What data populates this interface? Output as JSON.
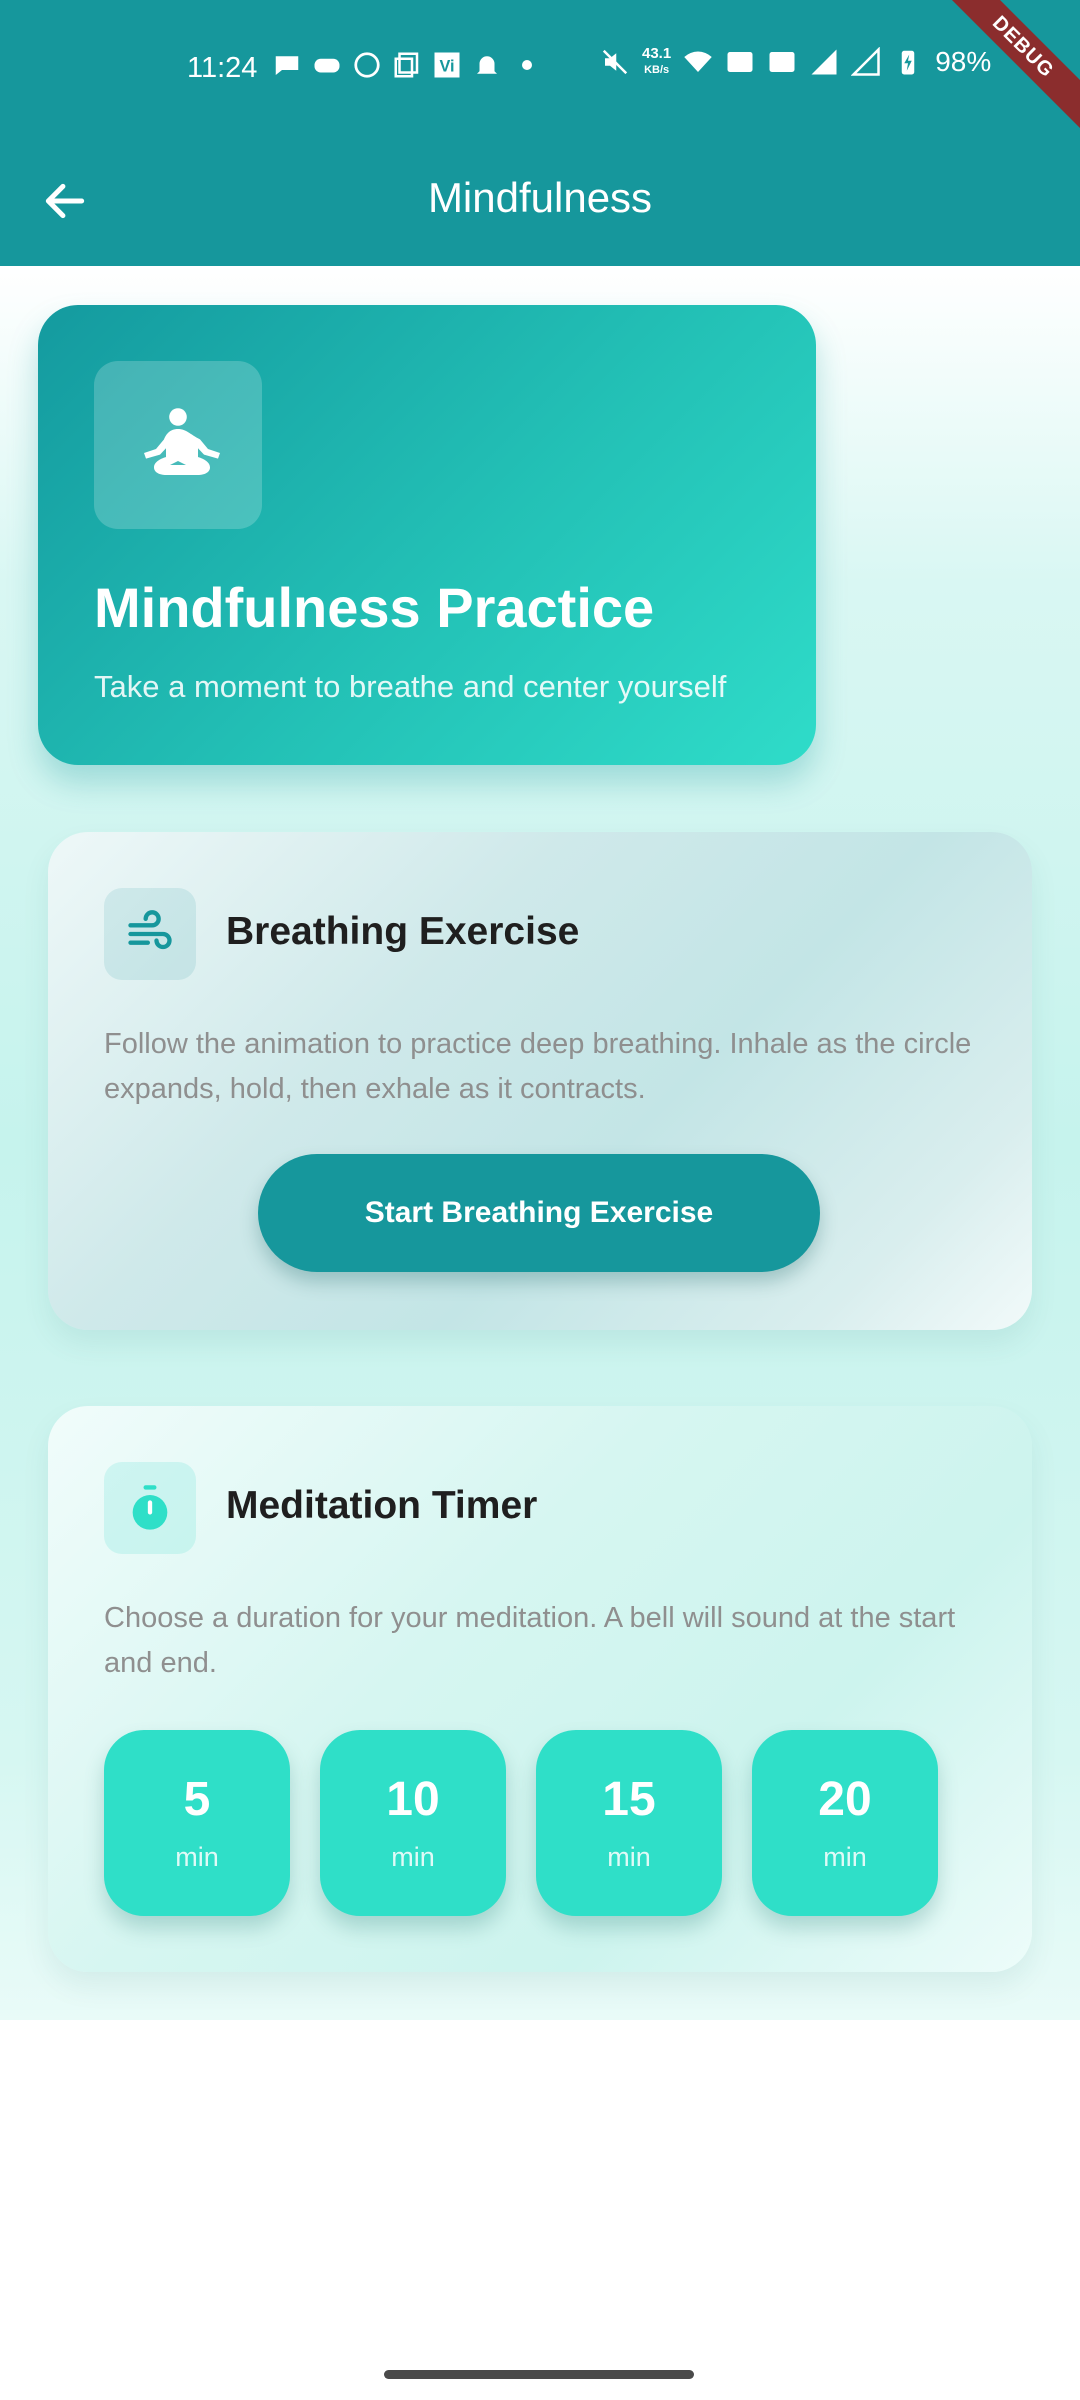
{
  "status_bar": {
    "time": "11:24",
    "network_speed_value": "43.1",
    "network_speed_unit": "KB/s",
    "battery": "98%",
    "icons": [
      "chat-bubble-icon",
      "gamepad-icon",
      "whatsapp-icon",
      "copy-icon",
      "vi-icon",
      "bell-icon",
      "dot-icon",
      "mute-icon",
      "wifi-icon",
      "vowifi-icon",
      "volte-icon",
      "signal-icon",
      "signal-icon-2",
      "battery-charging-icon"
    ]
  },
  "debug_banner": "DEBUG",
  "app_bar": {
    "title": "Mindfulness",
    "back_icon": "arrow-back-icon"
  },
  "hero": {
    "icon": "meditation-icon",
    "title": "Mindfulness Practice",
    "subtitle": "Take a moment to breathe and center yourself"
  },
  "breathing": {
    "icon": "wind-icon",
    "title": "Breathing Exercise",
    "description": "Follow the animation to practice deep breathing. Inhale as the circle expands, hold, then exhale as it contracts.",
    "button_label": "Start Breathing Exercise"
  },
  "timer": {
    "icon": "stopwatch-icon",
    "title": "Meditation Timer",
    "description": "Choose a duration for your meditation. A bell will sound at the start and end.",
    "durations": [
      {
        "value": "5",
        "unit": "min"
      },
      {
        "value": "10",
        "unit": "min"
      },
      {
        "value": "15",
        "unit": "min"
      },
      {
        "value": "20",
        "unit": "min"
      }
    ]
  },
  "colors": {
    "primary": "#16979C",
    "accent": "#2FDFC8"
  }
}
